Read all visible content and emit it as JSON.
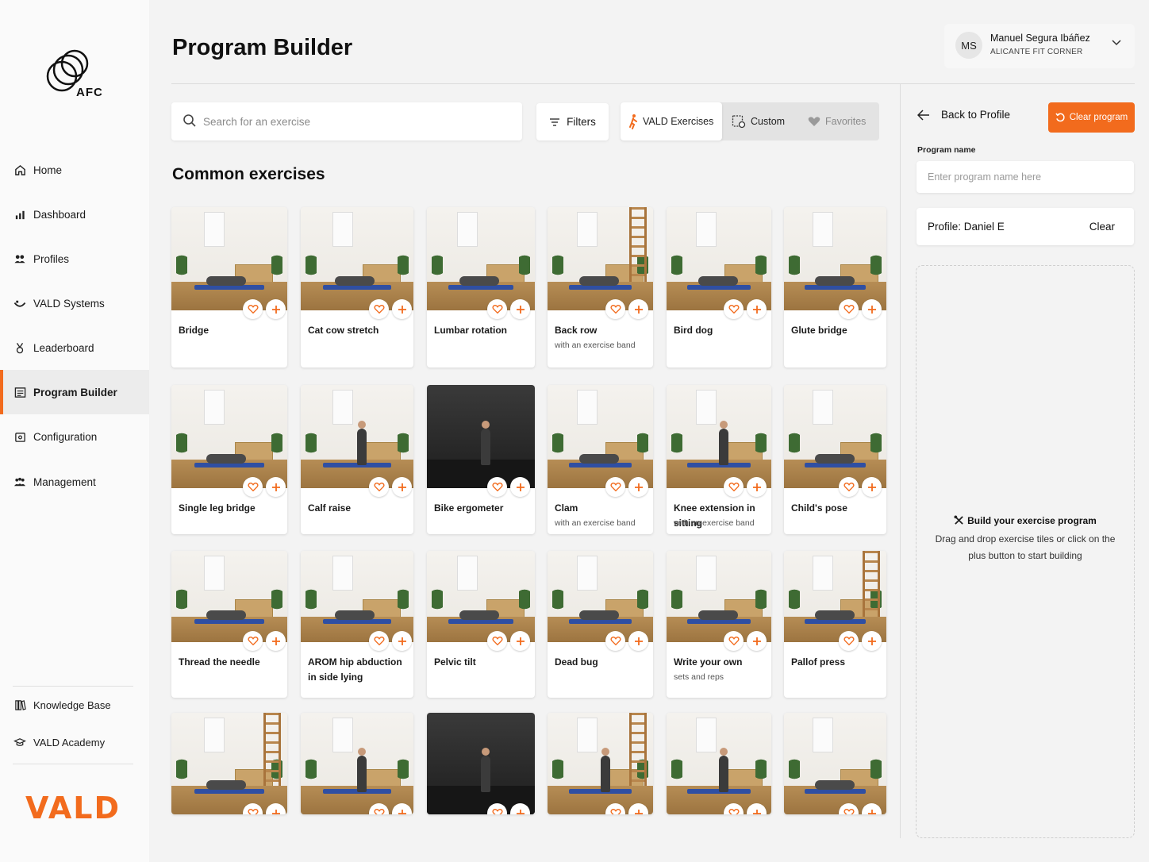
{
  "brand": {
    "org_logo_text": "AFC",
    "footer_logo": "VALD",
    "accent": "#f26b1d"
  },
  "sidebar": {
    "items": [
      {
        "label": "Home",
        "icon": "home-icon"
      },
      {
        "label": "Dashboard",
        "icon": "dashboard-icon"
      },
      {
        "label": "Profiles",
        "icon": "profiles-icon"
      },
      {
        "label": "VALD Systems",
        "icon": "systems-icon"
      },
      {
        "label": "Leaderboard",
        "icon": "medal-icon"
      },
      {
        "label": "Program Builder",
        "icon": "list-icon",
        "active": true
      },
      {
        "label": "Configuration",
        "icon": "config-icon"
      },
      {
        "label": "Management",
        "icon": "management-icon"
      }
    ],
    "bottom": [
      {
        "label": "Knowledge Base",
        "icon": "book-icon"
      },
      {
        "label": "VALD Academy",
        "icon": "graduation-icon"
      }
    ]
  },
  "header": {
    "title": "Program Builder",
    "user": {
      "initials": "MS",
      "name": "Manuel Segura Ibáñez",
      "org": "ALICANTE FIT CORNER"
    }
  },
  "toolbar": {
    "search_placeholder": "Search for an exercise",
    "filters_label": "Filters",
    "tabs": [
      {
        "label": "VALD Exercises",
        "active": true
      },
      {
        "label": "Custom"
      },
      {
        "label": "Favorites"
      }
    ]
  },
  "section_title": "Common exercises",
  "exercises": [
    {
      "name": "Bridge",
      "sub": ""
    },
    {
      "name": "Cat cow stretch",
      "sub": ""
    },
    {
      "name": "Lumbar rotation",
      "sub": ""
    },
    {
      "name": "Back row",
      "sub": "with an exercise band"
    },
    {
      "name": "Bird dog",
      "sub": ""
    },
    {
      "name": "Glute bridge",
      "sub": ""
    },
    {
      "name": "Single leg bridge",
      "sub": ""
    },
    {
      "name": "Calf raise",
      "sub": ""
    },
    {
      "name": "Bike ergometer",
      "sub": ""
    },
    {
      "name": "Clam",
      "sub": "with an exercise band"
    },
    {
      "name": "Knee extension in sitting",
      "sub": "with an exercise band"
    },
    {
      "name": "Child's pose",
      "sub": ""
    },
    {
      "name": "Thread the needle",
      "sub": ""
    },
    {
      "name": "AROM hip abduction in side lying",
      "sub": ""
    },
    {
      "name": "Pelvic tilt",
      "sub": ""
    },
    {
      "name": "Dead bug",
      "sub": ""
    },
    {
      "name": "Write your own",
      "sub": "sets and reps"
    },
    {
      "name": "Pallof press",
      "sub": ""
    },
    {
      "name": "",
      "sub": ""
    },
    {
      "name": "",
      "sub": ""
    },
    {
      "name": "",
      "sub": ""
    },
    {
      "name": "",
      "sub": ""
    },
    {
      "name": "",
      "sub": ""
    },
    {
      "name": "",
      "sub": ""
    }
  ],
  "panel": {
    "back_label": "Back to Profile",
    "clear_program_label": "Clear program",
    "program_name_label": "Program name",
    "program_name_placeholder": "Enter program name here",
    "profile_label": "Profile: Daniel E",
    "profile_clear": "Clear",
    "empty_title": "Build your exercise program",
    "empty_text": "Drag and drop exercise tiles or click on the plus button to start building"
  }
}
